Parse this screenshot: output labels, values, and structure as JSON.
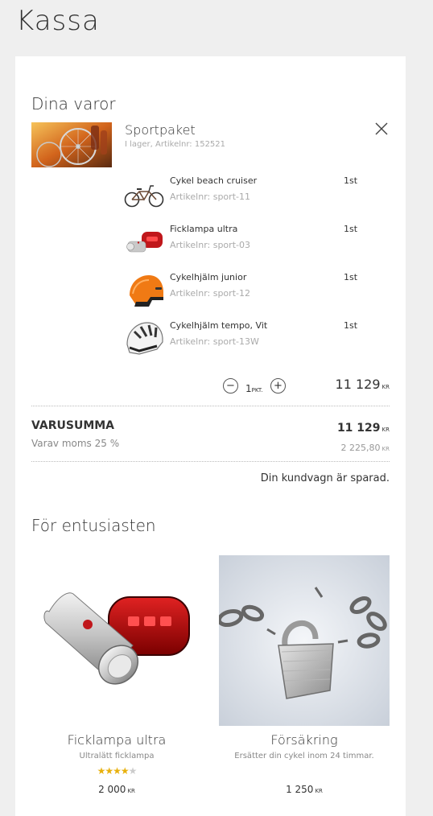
{
  "page": {
    "title": "Kassa"
  },
  "cart": {
    "heading": "Dina varor",
    "item": {
      "name": "Sportpaket",
      "meta": "I lager, Artikelnr: 152521",
      "included": [
        {
          "name": "Cykel beach cruiser",
          "sku": "Artikelnr: sport-11",
          "qty": "1st",
          "icon": "bicycle-icon"
        },
        {
          "name": "Ficklampa ultra",
          "sku": "Artikelnr: sport-03",
          "qty": "1st",
          "icon": "flashlight-icon"
        },
        {
          "name": "Cykelhjälm junior",
          "sku": "Artikelnr: sport-12",
          "qty": "1st",
          "icon": "orange-helmet-icon"
        },
        {
          "name": "Cykelhjälm tempo, Vit",
          "sku": "Artikelnr: sport-13W",
          "qty": "1st",
          "icon": "white-helmet-icon"
        }
      ],
      "quantity": "1",
      "quantity_unit": "PKT.",
      "price": "11 129",
      "currency": "KR"
    },
    "summary": {
      "label": "VARUSUMMA",
      "total": "11 129",
      "currency": "KR",
      "tax_label": "Varav moms 25 %",
      "tax_amount": "2 225,80",
      "tax_currency": "KR"
    },
    "saved_message": "Din kundvagn är sparad."
  },
  "recommendations": {
    "heading": "För entusiasten",
    "products": [
      {
        "name": "Ficklampa ultra",
        "subtitle": "Ultralätt ficklampa",
        "rating": 4,
        "price": "2 000",
        "currency": "KR"
      },
      {
        "name": "Försäkring",
        "subtitle": "Ersätter din cykel inom 24 timmar.",
        "price": "1 250",
        "currency": "KR"
      }
    ]
  },
  "colors": {
    "star": "#e8b10e",
    "background": "#efefef",
    "panel": "#ffffff"
  }
}
